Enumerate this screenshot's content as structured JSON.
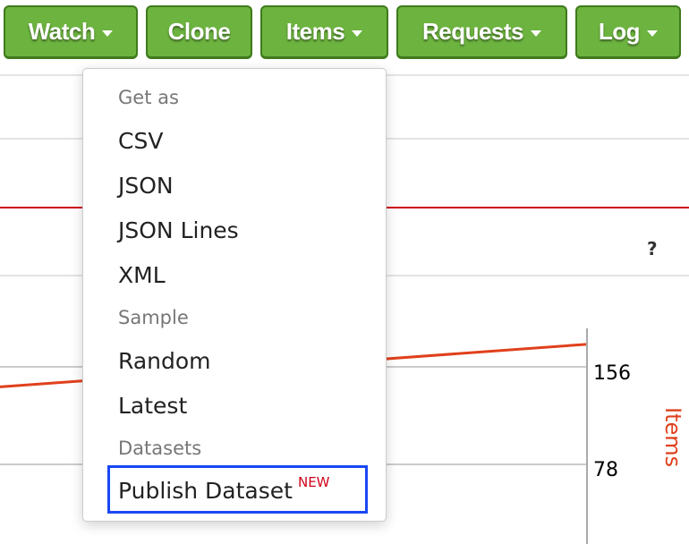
{
  "toolbar": {
    "watch": "Watch",
    "clone": "Clone",
    "items": "Items",
    "requests": "Requests",
    "log": "Log"
  },
  "help": "?",
  "menu": {
    "header_get_as": "Get as",
    "csv": "CSV",
    "json": "JSON",
    "json_lines": "JSON Lines",
    "xml": "XML",
    "header_sample": "Sample",
    "random": "Random",
    "latest": "Latest",
    "header_datasets": "Datasets",
    "publish_dataset": "Publish Dataset",
    "new_badge": "NEW"
  },
  "chart_data": {
    "type": "line",
    "ylabel": "Items",
    "y_ticks": [
      "156",
      "78"
    ],
    "series": [
      {
        "values": [
          140,
          174
        ]
      }
    ],
    "colors": {
      "line": "#e0401c",
      "ylabel": "#e0401c"
    }
  }
}
